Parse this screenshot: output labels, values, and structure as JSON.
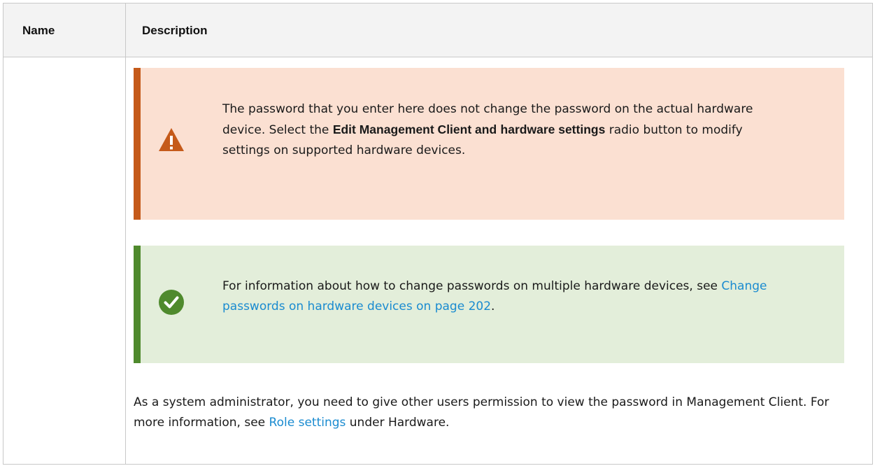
{
  "table": {
    "headers": {
      "name": "Name",
      "description": "Description"
    }
  },
  "warning_note": {
    "icon": "warning-icon",
    "accent_color": "#c55a1a",
    "background_color": "#fbe0d2",
    "text_before": "The password that you enter here does not change the password on the actual hardware device. Select the ",
    "bold_1": "Edit Management Client and",
    "bold_2": "hardware settings",
    "text_after": " radio button to modify settings on supported hardware devices."
  },
  "tip_note": {
    "icon": "check-circle-icon",
    "accent_color": "#4f8a2d",
    "background_color": "#e3eeda",
    "text_before": "For information about how to change passwords on multiple hardware devices, see ",
    "link_text": "Change passwords on hardware devices on page 202",
    "text_after": "."
  },
  "paragraph": {
    "text_before": "As a system administrator, you need to give other users permission to view the password in Management Client. For more information, see ",
    "link_text": "Role settings",
    "text_after": " under Hardware."
  }
}
